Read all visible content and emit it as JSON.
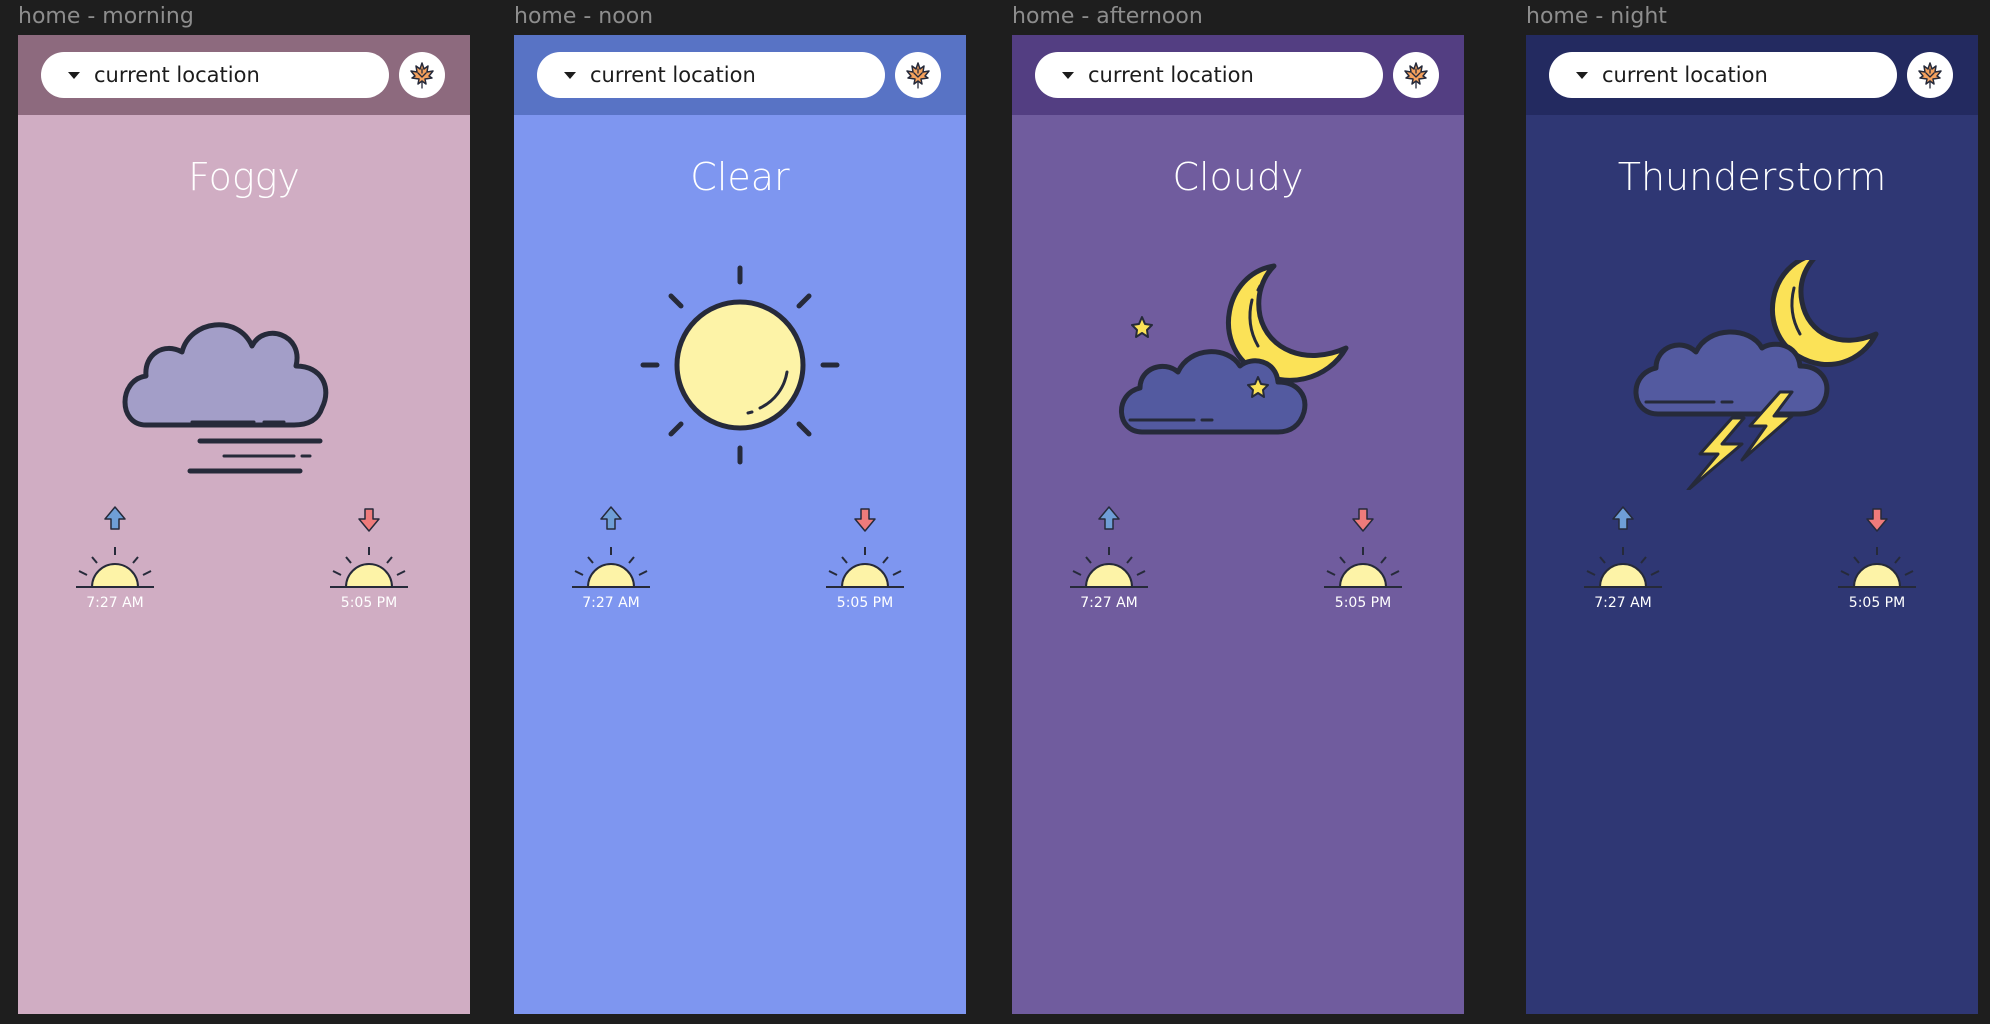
{
  "colors": {
    "canvas": "#1e1e1e",
    "label": "#8d8d8d",
    "sun_fill": "#fdf3a7",
    "moon_fill": "#fbe257",
    "outline": "#262a3a",
    "arrow_up": "#6f9ed6",
    "arrow_down": "#ef7b7b"
  },
  "screens": [
    {
      "frame_label": "home - morning",
      "location": "current location",
      "condition": "Foggy",
      "icon": "fog-cloud-icon",
      "bg": "#d0adc3",
      "topbar_bg": "#8d6a7e",
      "sunrise": "7:27 AM",
      "sunset": "5:05 PM"
    },
    {
      "frame_label": "home - noon",
      "location": "current location",
      "condition": "Clear",
      "icon": "sun-icon",
      "bg": "#7e96f0",
      "topbar_bg": "#5873c5",
      "sunrise": "7:27 AM",
      "sunset": "5:05 PM"
    },
    {
      "frame_label": "home - afternoon",
      "location": "current location",
      "condition": "Cloudy",
      "icon": "cloud-moon-icon",
      "bg": "#705c9e",
      "topbar_bg": "#533e82",
      "sunrise": "7:27 AM",
      "sunset": "5:05 PM"
    },
    {
      "frame_label": "home - night",
      "location": "current location",
      "condition": "Thunderstorm",
      "icon": "thunderstorm-moon-icon",
      "bg": "#2f3774",
      "topbar_bg": "#232a60",
      "sunrise": "7:27 AM",
      "sunset": "5:05 PM"
    }
  ]
}
